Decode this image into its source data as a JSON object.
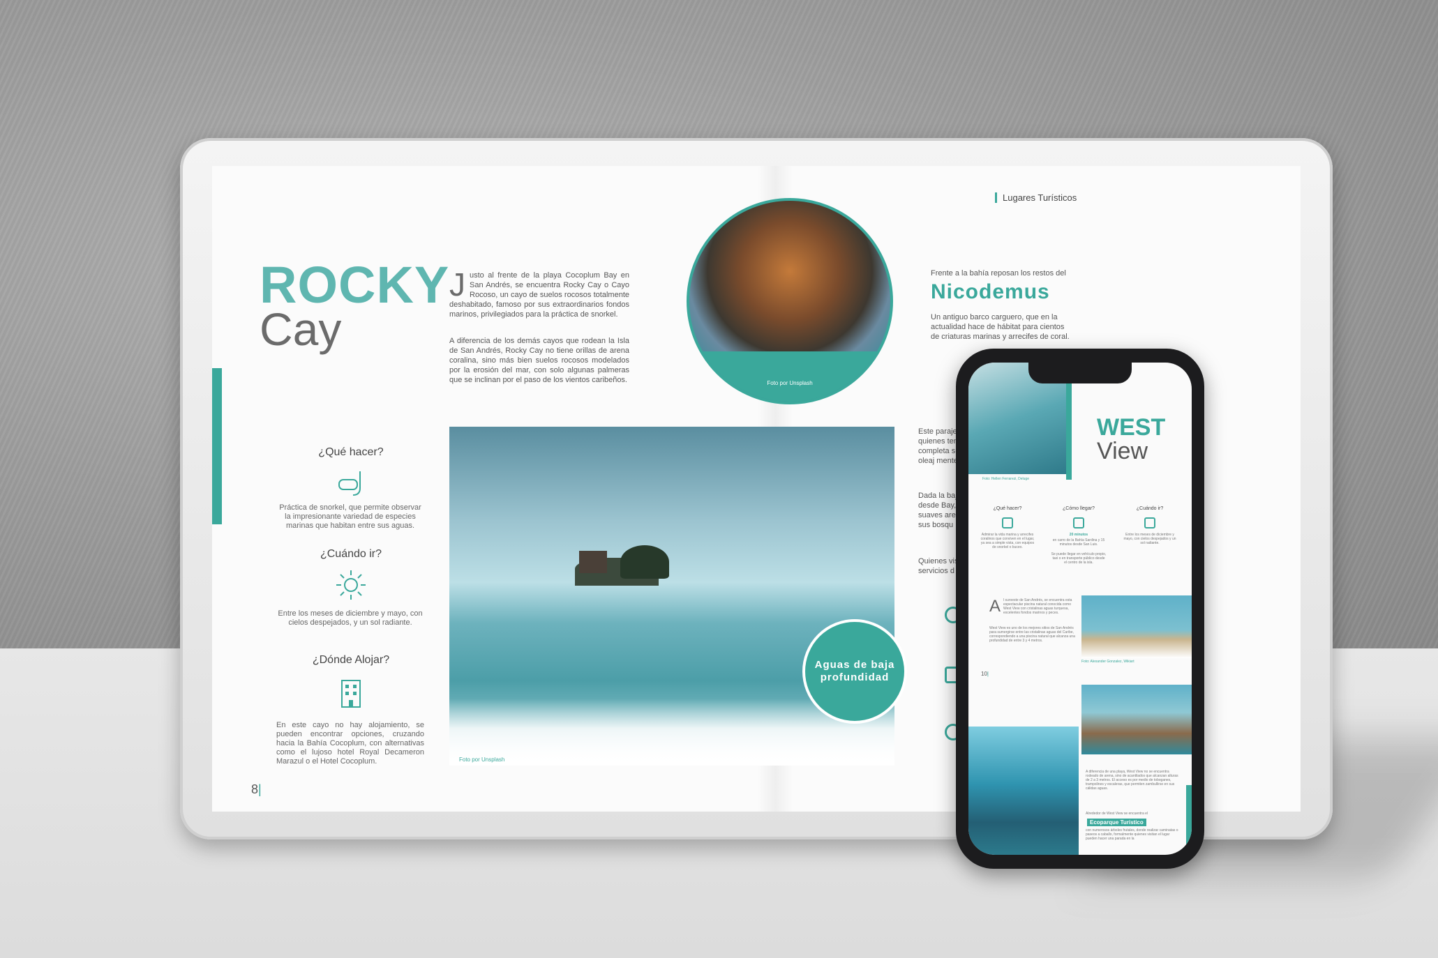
{
  "tablet": {
    "header": {
      "section": "Lugares Turísticos"
    },
    "title": {
      "line1": "ROCKY",
      "line2": "Cay"
    },
    "intro": {
      "dropcap": "J",
      "paragraph1": "usto al frente de la playa Cocoplum Bay en San Andrés, se encuentra Rocky Cay o Cayo Rocoso, un cayo de suelos rocosos totalmente deshabitado, famoso por sus extraordinarios fondos marinos, privilegiados para la práctica de snorkel.",
      "paragraph2": "A diferencia de los demás cayos que rodean la Isla de San Andrés, Rocky Cay no tiene orillas de arena coralina, sino más bien suelos rocosos modelados por la erosión del mar, con solo algunas palmeras que se inclinan por el paso de los vientos caribeños."
    },
    "sidebar": [
      {
        "heading": "¿Qué hacer?",
        "icon": "snorkel-icon",
        "text": "Práctica de snorkel, que permite observar la impresionante variedad de especies marinas que habitan entre sus aguas."
      },
      {
        "heading": "¿Cuándo ir?",
        "icon": "sun-icon",
        "text": "Entre los meses de diciembre y mayo, con cielos despejados, y un sol radiante."
      },
      {
        "heading": "¿Dónde Alojar?",
        "icon": "building-icon",
        "text": "En este cayo no hay alojamiento, se pueden encontrar opciones, cruzando hacia la Bahía Cocoplum, con alternativas como el lujoso hotel Royal Decameron Marazul o el Hotel Cocoplum."
      }
    ],
    "circle_photo": {
      "caption": "Foto por Unsplash"
    },
    "nicodemus": {
      "lead": "Frente a la bahía reposan los restos del",
      "name": "Nicodemus",
      "text": "Un antiguo barco carguero, que en la actualidad hace de hábitat para cientos de criaturas marinas y arrecifes de coral."
    },
    "sea_photo": {
      "caption": "Foto por Unsplash",
      "badge": "Aguas de baja profundidad"
    },
    "right_col": {
      "p1": "Este paraje, para quienes ten completa su bajo oleaj mente sencil",
      "p2": "Dada la baja minar desde Bay, playa qu suaves arena por sus bosqu",
      "p3": "Quienes visit de servicios d"
    },
    "page_number": "8"
  },
  "phone": {
    "title": {
      "line1": "WEST",
      "line2": "View"
    },
    "photo1_caption": "Foto: Hellen Ferrarezi, Deluge",
    "cols": [
      {
        "heading": "¿Qué hacer?",
        "text": "Admirar la vida marina y arrecifes coralinos que conviven en el lugar, ya sea a simple vista, con equipos de snorkel o buceo."
      },
      {
        "heading": "¿Cómo llegar?",
        "highlight": "20 minutos",
        "text": "en carro de la Bahía Sardina y 15 minutos desde San Luis.",
        "extra": "Se puede llegar en vehículo propio, taxi o en transporte público desde el centro de la isla."
      },
      {
        "heading": "¿Cuándo ir?",
        "text": "Entre los meses de diciembre y mayo, con cielos despejados y un sol radiante."
      }
    ],
    "dropcap": "A",
    "intro": "l suroeste de San Andrés, se encuentra esta espectacular piscina natural conocida como West View con cristalinas aguas turquesa, excelentes fondos marinos y peces.",
    "intro2": "West View es uno de los mejores sitios de San Andrés para sumergirse entre las cristalinas aguas del Caribe, correspondiendo a una piscina natural que alcanza una profundidad de entre 3 y 4 metros.",
    "photo2_caption": "Foto: Alexander Gonzalez, Wikiart",
    "page_number": "10",
    "body": "A diferencia de una playa, West View no se encuentra rodeado de arena, sino de acantilados que alcanzan alturas de 2 a 3 metros. El acceso es por medio de toboganes, trampolines y escaleras, que permiten zambullirse en sus cálidas aguas.",
    "eco_lead": "Alrededor de West View se encuentra el",
    "eco": "Ecoparque Turístico",
    "eco_text": "con numerosos árboles frutales, donde realizar caminatas o paseos a caballo, formalmente quienes visitan el lugar pueden hacer una parada en la"
  },
  "colors": {
    "accent": "#3aa89b"
  }
}
